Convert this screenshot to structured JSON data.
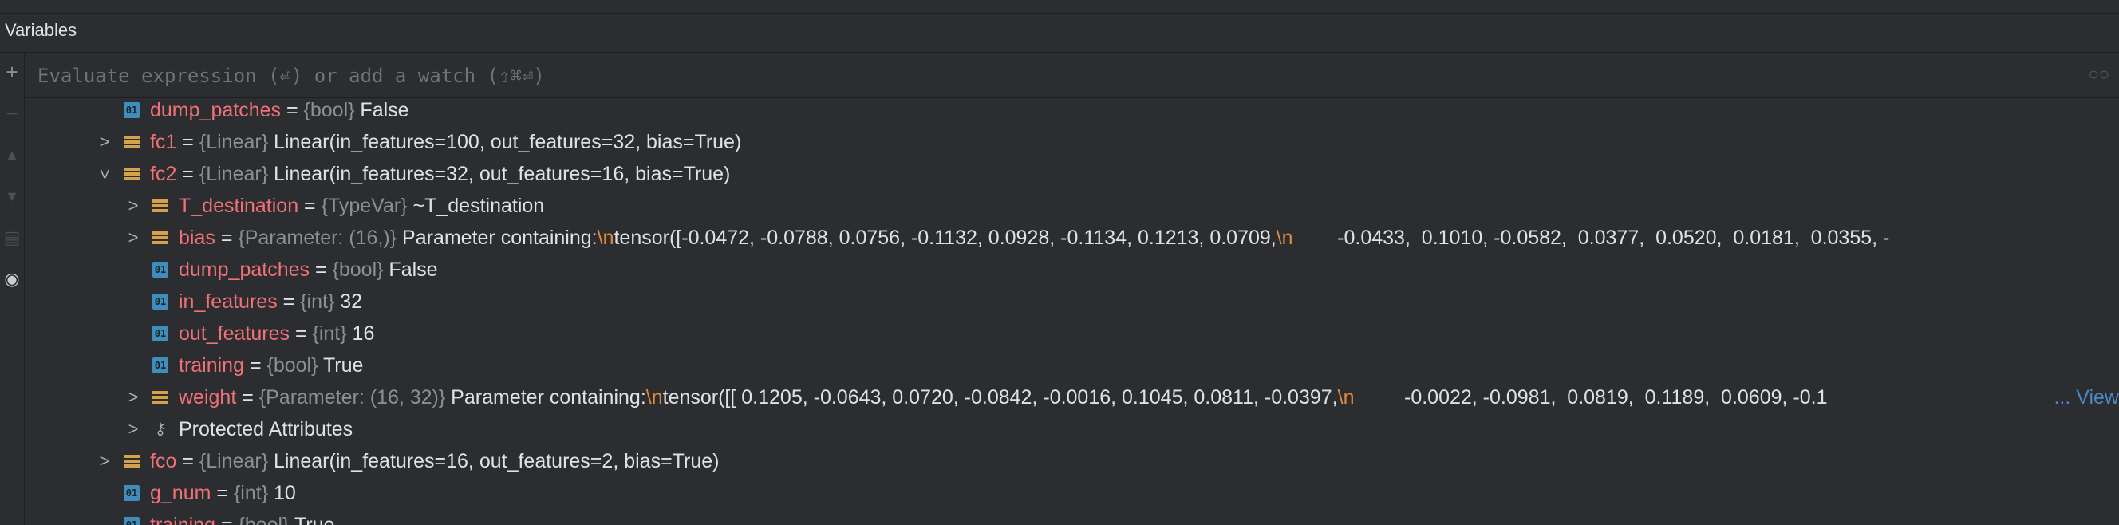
{
  "panel": {
    "title": "Variables"
  },
  "toolbar": {
    "icons": [
      "plus-icon",
      "minus-icon",
      "up-icon",
      "down-icon",
      "copy-icon",
      "eye-icon"
    ]
  },
  "eval": {
    "placeholder": "Evaluate expression (⏎) or add a watch (⇧⌘⏎)"
  },
  "rows": [
    {
      "name": "dump_patches",
      "eq": " = ",
      "type": "{bool}",
      "value": " False"
    },
    {
      "name": "fc1",
      "eq": " = ",
      "type": "{Linear}",
      "value": " Linear(in_features=100, out_features=32, bias=True)"
    },
    {
      "name": "fc2",
      "eq": " = ",
      "type": "{Linear}",
      "value": " Linear(in_features=32, out_features=16, bias=True)"
    },
    {
      "name": "T_destination",
      "eq": " = ",
      "type": "{TypeVar}",
      "value": " ~T_destination"
    },
    {
      "name": "bias",
      "eq": " = ",
      "type": "{Parameter: (16,)}",
      "value": " Parameter containing:",
      "esc1": "\\n",
      "value2": "tensor([-0.0472, -0.0788,  0.0756, -0.1132,  0.0928, -0.1134,  0.1213,  0.0709,",
      "esc2": "\\n",
      "value3": "        -0.0433,  0.1010, -0.0582,  0.0377,  0.0520,  0.0181,  0.0355, -"
    },
    {
      "name": "dump_patches",
      "eq": " = ",
      "type": "{bool}",
      "value": " False"
    },
    {
      "name": "in_features",
      "eq": " = ",
      "type": "{int}",
      "value": " 32"
    },
    {
      "name": "out_features",
      "eq": " = ",
      "type": "{int}",
      "value": " 16"
    },
    {
      "name": "training",
      "eq": " = ",
      "type": "{bool}",
      "value": " True"
    },
    {
      "name": "weight",
      "eq": " = ",
      "type": "{Parameter: (16, 32)}",
      "value": " Parameter containing:",
      "esc1": "\\n",
      "value2": "tensor([[ 0.1205, -0.0643,  0.0720, -0.0842, -0.0016,  0.1045,  0.0811, -0.0397,",
      "esc2": "\\n",
      "value3": "         -0.0022, -0.0981,  0.0819,  0.1189,  0.0609, -0.1",
      "link": "... View"
    },
    {
      "label": "Protected Attributes"
    },
    {
      "name": "fco",
      "eq": " = ",
      "type": "{Linear}",
      "value": " Linear(in_features=16, out_features=2, bias=True)"
    },
    {
      "name": "g_num",
      "eq": " = ",
      "type": "{int}",
      "value": " 10"
    },
    {
      "name": "training",
      "eq": " = ",
      "type": "{bool}",
      "value": " True"
    }
  ],
  "colors": {
    "name": "#f07178",
    "type": "#8c8f94",
    "escape": "#e08a3c",
    "object_icon": "#d4a24a",
    "field_icon": "#3d8ebc",
    "background": "#2b2d30"
  }
}
